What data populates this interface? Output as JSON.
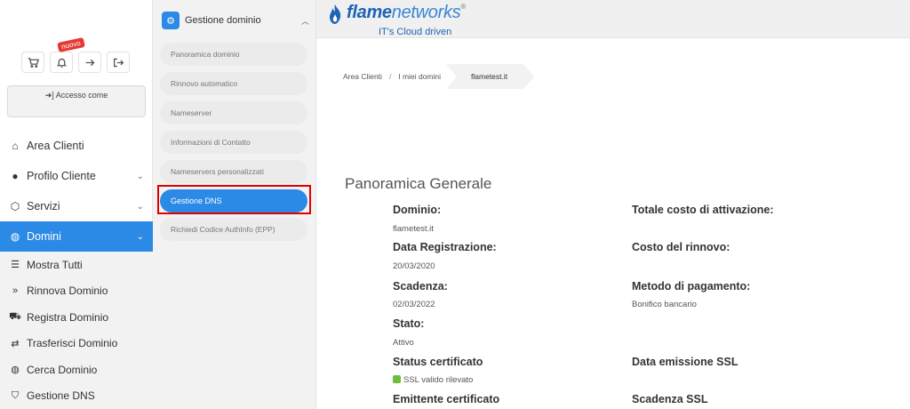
{
  "sidebar": {
    "badge_new": "nuovo",
    "access_label": "Accesso come",
    "items": [
      {
        "label": "Area Clienti",
        "icon": "home-icon"
      },
      {
        "label": "Profilo Cliente",
        "icon": "user-icon"
      },
      {
        "label": "Servizi",
        "icon": "cube-icon"
      },
      {
        "label": "Domini",
        "icon": "globe-icon"
      }
    ],
    "sub_items": [
      {
        "label": "Mostra Tutti",
        "icon": "list-icon"
      },
      {
        "label": "Rinnova Dominio",
        "icon": "double-chevron-icon"
      },
      {
        "label": "Registra Dominio",
        "icon": "cart-icon"
      },
      {
        "label": "Trasferisci Dominio",
        "icon": "transfer-icon"
      },
      {
        "label": "Cerca Dominio",
        "icon": "globe-icon"
      },
      {
        "label": "Gestione DNS",
        "icon": "shield-icon"
      }
    ]
  },
  "panel": {
    "title": "Gestione dominio",
    "items": [
      "Panoramica dominio",
      "Rinnovo automatico",
      "Nameserver",
      "Informazioni di Contatto",
      "Nameservers personalizzati",
      "Gestione DNS",
      "Richiedi Codice AuthInfo (EPP)"
    ]
  },
  "header": {
    "brand_bold": "flame",
    "brand_light": "networks",
    "tagline": "IT's Cloud driven"
  },
  "breadcrumb": [
    "Area Clienti",
    "I miei domini",
    "flametest.it"
  ],
  "overview": {
    "title": "Panoramica Generale",
    "left": [
      {
        "label": "Dominio:",
        "value": "flametest.it"
      },
      {
        "label": "Data Registrazione:",
        "value": "20/03/2020"
      },
      {
        "label": "Scadenza:",
        "value": "02/03/2022"
      },
      {
        "label": "Stato:",
        "value": "Attivo"
      },
      {
        "label": "Status certificato",
        "value": "SSL valido rilevato"
      },
      {
        "label": "Emittente certificato",
        "value": ""
      }
    ],
    "right": [
      {
        "label": "Totale costo di attivazione:",
        "value": ""
      },
      {
        "label": "Costo del rinnovo:",
        "value": ""
      },
      {
        "label": "Metodo di pagamento:",
        "value": "Bonifico bancario"
      },
      {
        "label": "Data emissione SSL",
        "value": ""
      },
      {
        "label": "Scadenza SSL",
        "value": ""
      }
    ]
  },
  "colors": {
    "accent": "#2b8ae5",
    "highlight": "#e00000",
    "brand": "#1e63b6"
  }
}
